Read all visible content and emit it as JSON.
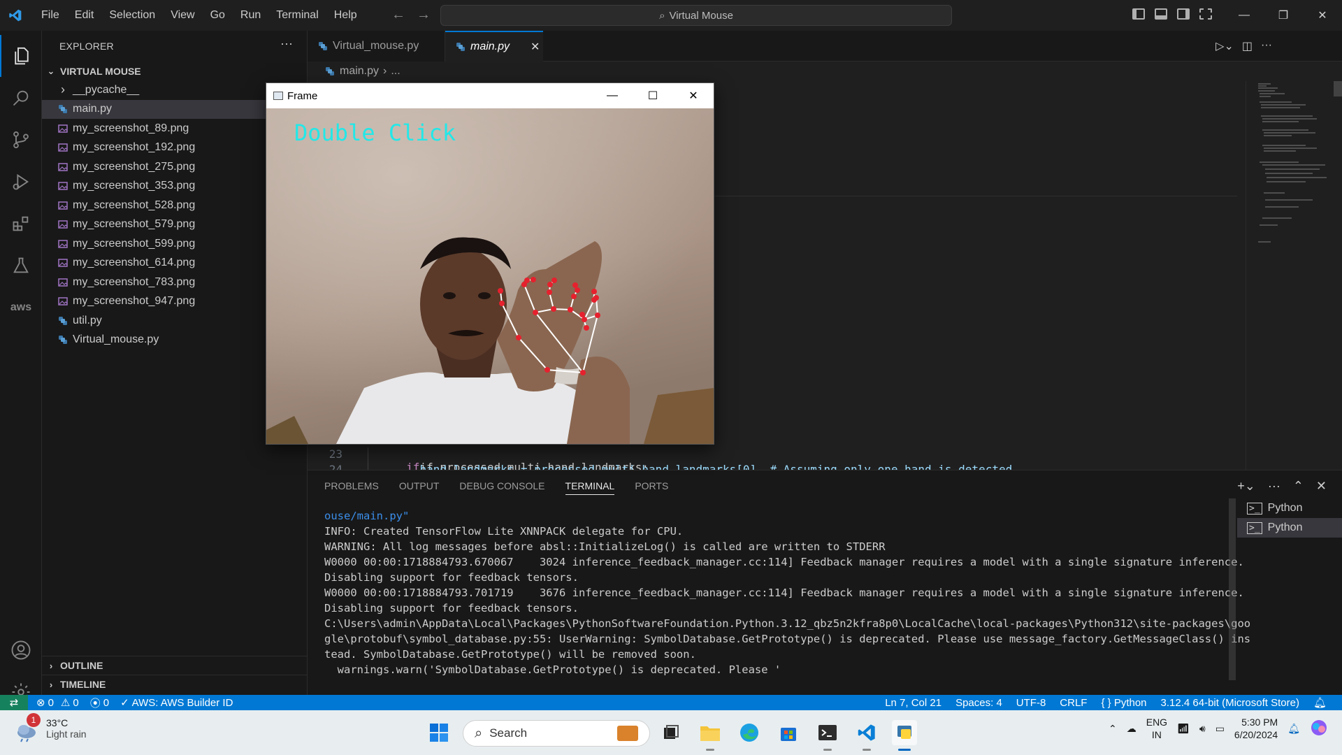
{
  "window": {
    "title": "Virtual Mouse",
    "menu": [
      "File",
      "Edit",
      "Selection",
      "View",
      "Go",
      "Run",
      "Terminal",
      "Help"
    ]
  },
  "explorer": {
    "header": "EXPLORER",
    "folder": "VIRTUAL MOUSE",
    "items": [
      {
        "name": "__pycache__",
        "type": "folder"
      },
      {
        "name": "main.py",
        "type": "py",
        "selected": true
      },
      {
        "name": "my_screenshot_89.png",
        "type": "png"
      },
      {
        "name": "my_screenshot_192.png",
        "type": "png"
      },
      {
        "name": "my_screenshot_275.png",
        "type": "png"
      },
      {
        "name": "my_screenshot_353.png",
        "type": "png"
      },
      {
        "name": "my_screenshot_528.png",
        "type": "png"
      },
      {
        "name": "my_screenshot_579.png",
        "type": "png"
      },
      {
        "name": "my_screenshot_599.png",
        "type": "png"
      },
      {
        "name": "my_screenshot_614.png",
        "type": "png"
      },
      {
        "name": "my_screenshot_783.png",
        "type": "png"
      },
      {
        "name": "my_screenshot_947.png",
        "type": "png"
      },
      {
        "name": "util.py",
        "type": "py"
      },
      {
        "name": "Virtual_mouse.py",
        "type": "py"
      }
    ],
    "outline": "OUTLINE",
    "timeline": "TIMELINE"
  },
  "tabs": [
    {
      "label": "Virtual_mouse.py",
      "active": false
    },
    {
      "label": "main.py",
      "active": true
    }
  ],
  "breadcrumb": {
    "file": "main.py",
    "rest": "..."
  },
  "code": {
    "lines": [
      {
        "num": "23",
        "text": "if processed.multi_hand_landmarks:"
      },
      {
        "num": "24",
        "text": "    hand_landmarks = processed.multi_hand_landmarks[0]  # Assuming only one hand is detected"
      }
    ]
  },
  "panel": {
    "tabs": [
      "PROBLEMS",
      "OUTPUT",
      "DEBUG CONSOLE",
      "TERMINAL",
      "PORTS"
    ],
    "active_tab": "TERMINAL",
    "terminal_lines": [
      "ouse/main.py\"",
      "INFO: Created TensorFlow Lite XNNPACK delegate for CPU.",
      "WARNING: All log messages before absl::InitializeLog() is called are written to STDERR",
      "W0000 00:00:1718884793.670067    3024 inference_feedback_manager.cc:114] Feedback manager requires a model with a single signature inference.",
      "Disabling support for feedback tensors.",
      "W0000 00:00:1718884793.701719    3676 inference_feedback_manager.cc:114] Feedback manager requires a model with a single signature inference.",
      "Disabling support for feedback tensors.",
      "C:\\Users\\admin\\AppData\\Local\\Packages\\PythonSoftwareFoundation.Python.3.12_qbz5n2kfra8p0\\LocalCache\\local-packages\\Python312\\site-packages\\goo",
      "gle\\protobuf\\symbol_database.py:55: UserWarning: SymbolDatabase.GetPrototype() is deprecated. Please use message_factory.GetMessageClass() ins",
      "tead. SymbolDatabase.GetPrototype() will be removed soon.",
      "  warnings.warn('SymbolDatabase.GetPrototype() is deprecated. Please '"
    ],
    "terminals": [
      "Python",
      "Python"
    ]
  },
  "status": {
    "errors": "0",
    "warnings": "0",
    "ports": "0",
    "aws": "AWS: AWS Builder ID",
    "position": "Ln 7, Col 21",
    "spaces": "Spaces: 4",
    "encoding": "UTF-8",
    "eol": "CRLF",
    "language": "Python",
    "interpreter": "3.12.4 64-bit (Microsoft Store)"
  },
  "frame_window": {
    "title": "Frame",
    "overlay_text": "Double Click",
    "overlay_color": "#22e8e8"
  },
  "taskbar": {
    "weather_temp": "33°C",
    "weather_desc": "Light rain",
    "notification_badge": "1",
    "search_label": "Search",
    "lang_top": "ENG",
    "lang_bottom": "IN",
    "time": "5:30 PM",
    "date": "6/20/2024"
  },
  "colors": {
    "accent": "#0078d4",
    "statusbar": "#0078d4",
    "remote": "#16825d"
  }
}
